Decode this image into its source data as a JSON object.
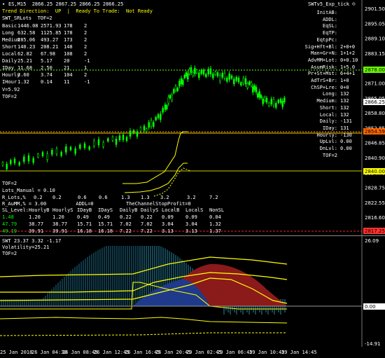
{
  "header": {
    "symbol_info": "ES,M15  2866.25 2867.25 2866.25 2866.25",
    "ea_label": "SWTv5_Exp_tick ☺"
  },
  "status": {
    "trend": "Trend Direction:  UP  |  Ready To Trade:  Not Ready",
    "swt_line": "SWT_SRLots  TOF=2"
  },
  "left_table": [
    [
      "Basic",
      "1446.08",
      "2571.93",
      "178",
      "2"
    ],
    [
      "Long",
      "632.58",
      "1125.85",
      "178",
      "2"
    ],
    [
      "Medium",
      "285.06",
      "493.27",
      "173",
      "2"
    ],
    [
      "Short",
      "140.23",
      "208.21",
      "148",
      "2"
    ],
    [
      "Local",
      "62.82",
      "67.98",
      "108",
      "2"
    ],
    [
      "Daily",
      "25.21",
      "5.17",
      "20",
      "-1"
    ],
    [
      "IDay",
      "11.68",
      "2.50",
      "21",
      "1"
    ],
    [
      "Hourly",
      "3.60",
      "3.74",
      "104",
      "2"
    ],
    [
      "IHour",
      "1.32",
      "0.14",
      "11",
      "-1"
    ]
  ],
  "left_extra": [
    "V=5.92",
    "TOF=2"
  ],
  "right_panel": [
    [
      "InitAB:",
      ""
    ],
    [
      "ADDL:",
      ""
    ],
    [
      "EqSL:",
      ""
    ],
    [
      "EqTP:",
      ""
    ],
    [
      "EqtpPc:",
      ""
    ],
    [
      "Sig+Hft+Bl:",
      "2+0+0"
    ],
    [
      "Man+Gr+N:",
      "1+1+2"
    ],
    [
      "AdvMM+Lot:",
      "0+0.10"
    ],
    [
      "AsumRisk:",
      "1+5.0"
    ],
    [
      "Pr+St+Mst:",
      "6+4+1"
    ],
    [
      "AdTrS+Br:",
      "1+0"
    ],
    [
      "ChSP+Lre:",
      "0+0"
    ],
    [
      "Long:",
      "132"
    ],
    [
      "Medium:",
      "132"
    ],
    [
      "Short:",
      "132"
    ],
    [
      "Local:",
      "132"
    ],
    [
      "Daily:",
      "-131"
    ],
    [
      "IDay:",
      "131"
    ],
    [
      "Hourly:",
      "-130"
    ],
    [
      "UpLvl:",
      "0.00"
    ],
    [
      "DnLvl:",
      "0.00"
    ],
    [
      "TOF=2",
      ""
    ]
  ],
  "lower_left": {
    "tof": "TOF=2",
    "lots_manual": "Lots_Manual = 0.10",
    "r_lots": [
      "R_Lots,%",
      "0.2",
      "0.2",
      "0.6",
      "0.6",
      "1.3",
      "1.3",
      "3.2",
      "3.2",
      "7.2"
    ],
    "aumm_line": "R_AuMM,% = 3.00          ADDL=0           TheChannelStopProfit=0",
    "sl_header": [
      "SL_Level:",
      "HourlyB",
      "HourlyS",
      "IDayB",
      "IDayS",
      "DailyB",
      "DailyS",
      "LocalB",
      "LocalS",
      "NonSL"
    ],
    "sl_rows": [
      [
        "1.48",
        "1.20",
        "1.20",
        "0.49",
        "0.49",
        "0.22",
        "0.22",
        "0.09",
        "0.09",
        "0.04"
      ],
      [
        "47.79",
        "38.77",
        "38.77",
        "15.71",
        "15.71",
        "7.02",
        "7.02",
        "3.04",
        "3.04",
        "1.32"
      ],
      [
        "49.19",
        "39.91",
        "39.91",
        "16.18",
        "16.18",
        "7.22",
        "7.22",
        "3.13",
        "3.13",
        "1.37"
      ]
    ]
  },
  "price_axis": {
    "labels": [
      "2901.50",
      "2895.05",
      "2889.10",
      "2883.15",
      "2877.20",
      "2871.00",
      "2865.05",
      "2858.80",
      "2852.85",
      "2846.85",
      "2840.90",
      "2834.70",
      "2828.75",
      "2822.55",
      "2816.60"
    ],
    "current_price": "2866.25",
    "tag_green": "2878.00",
    "tag_orange": "2854.59",
    "tag_green2": "2840.00",
    "tag_red": "2817.25"
  },
  "indicator": {
    "title": "SWT 23.37 3.32 -1.17",
    "volatility": "Volatility=25.21",
    "tof": "TOF=2",
    "axis_labels": [
      "26.09",
      "0.00",
      "-14.91"
    ]
  },
  "time_axis": [
    "25 Jan 2018",
    "26 Jan 04:30",
    "26 Jan 08:45",
    "26 Jan 12:45",
    "26 Jan 16:45",
    "26 Jan 20:45",
    "29 Jan 02:45",
    "29 Jan 06:45",
    "29 Jan 10:45",
    "29 Jan 14:45"
  ],
  "colors": {
    "candle_up": "#00ff00",
    "yellow": "#ffff00",
    "orange_line": "#ff9900",
    "red_line": "#ff3030",
    "bg": "#000000",
    "grid_text": "#ffffff"
  }
}
